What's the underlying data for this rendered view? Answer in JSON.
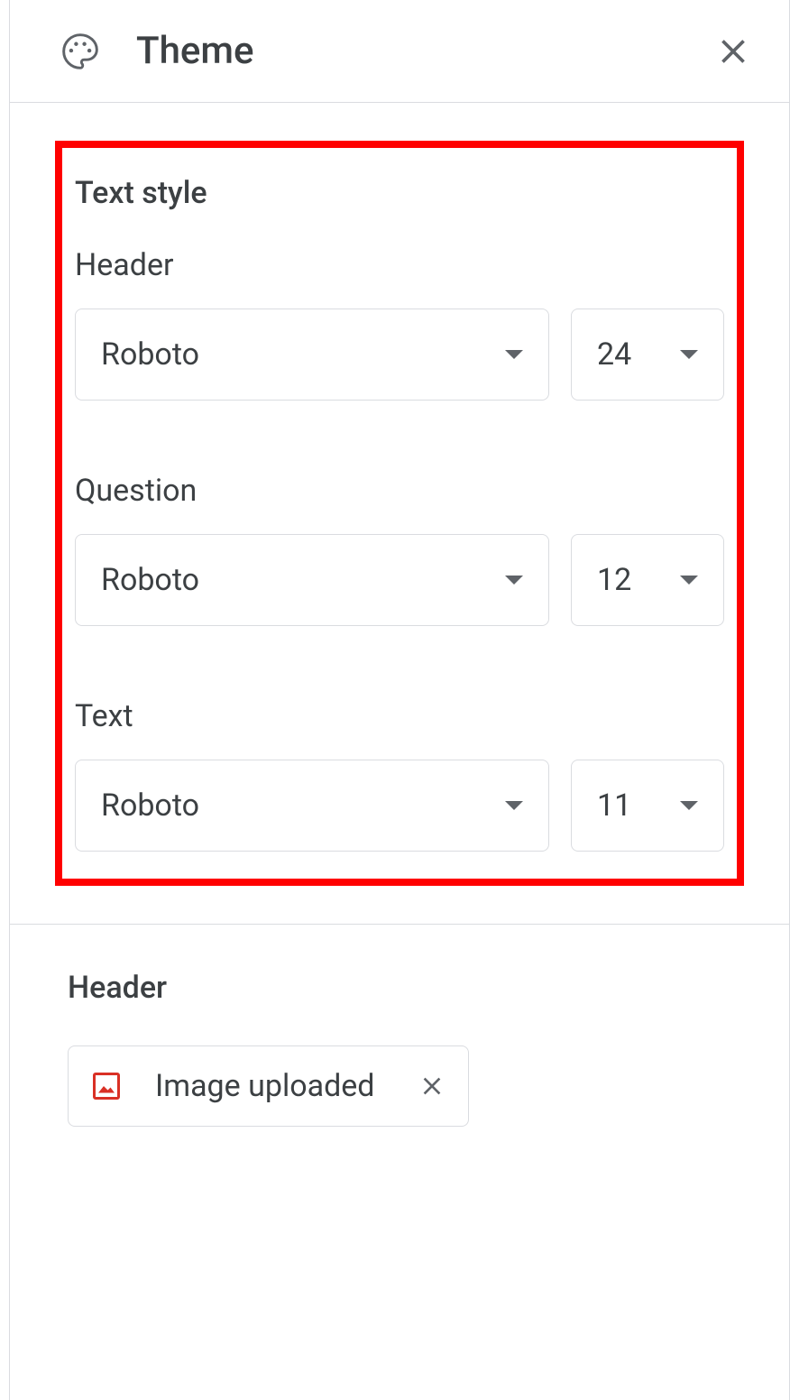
{
  "panel": {
    "title": "Theme"
  },
  "text_style": {
    "section_label": "Text style",
    "fields": [
      {
        "label": "Header",
        "font": "Roboto",
        "size": "24"
      },
      {
        "label": "Question",
        "font": "Roboto",
        "size": "12"
      },
      {
        "label": "Text",
        "font": "Roboto",
        "size": "11"
      }
    ]
  },
  "header_section": {
    "label": "Header",
    "upload_text": "Image uploaded"
  }
}
